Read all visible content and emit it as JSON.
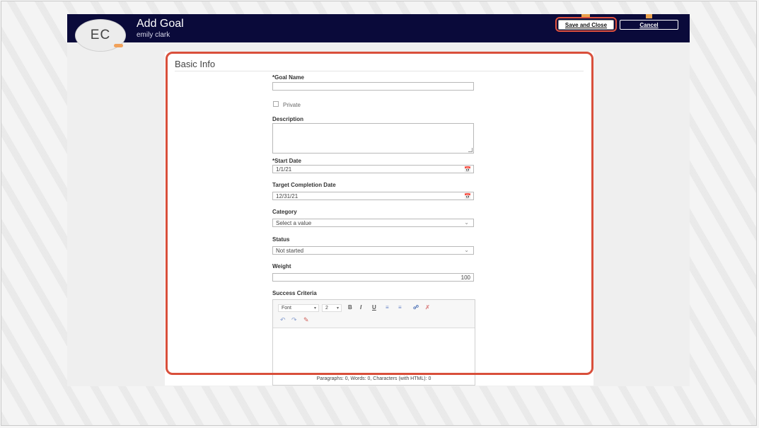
{
  "header": {
    "title": "Add Goal",
    "user_name": "emily clark",
    "avatar_initials": "EC",
    "save_label": "Save and Close",
    "cancel_label": "Cancel",
    "colors": {
      "bar": "#0a0a3a",
      "highlight": "#e0513d"
    }
  },
  "form": {
    "section_title": "Basic Info",
    "goal_name": {
      "required_mark": "*",
      "label": "Goal Name",
      "value": ""
    },
    "private": {
      "label": "Private",
      "checked": false
    },
    "description": {
      "label": "Description",
      "value": ""
    },
    "start_date": {
      "required_mark": "*",
      "label": "Start Date",
      "value": "1/1/21",
      "icon": "calendar-icon"
    },
    "target_date": {
      "label": "Target Completion Date",
      "value": "12/31/21",
      "icon": "calendar-icon"
    },
    "category": {
      "label": "Category",
      "value": "Select a value",
      "icon": "chevron-down-icon"
    },
    "status": {
      "label": "Status",
      "value": "Not started",
      "icon": "chevron-down-icon"
    },
    "weight": {
      "label": "Weight",
      "value": "100"
    },
    "success_criteria": {
      "label": "Success Criteria",
      "toolbar": {
        "font": "Font",
        "size": "2",
        "bold": "B",
        "italic": "I",
        "underline": "U",
        "icons": [
          "numbered-list-icon",
          "bullet-list-icon",
          "insert-link-icon",
          "remove-link-icon",
          "undo-icon",
          "redo-icon",
          "clear-format-icon"
        ]
      },
      "status_bar": "Paragraphs: 0, Words: 0, Characters (with HTML): 0"
    }
  }
}
